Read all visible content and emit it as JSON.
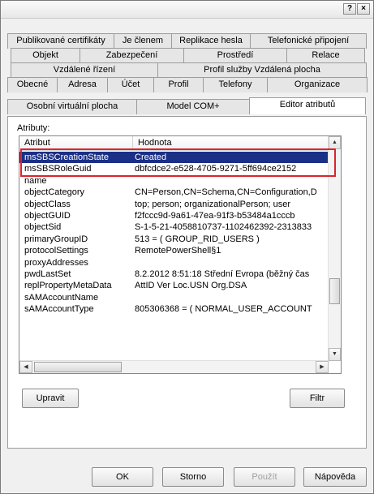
{
  "titlebar": {
    "help": "?",
    "close": "×"
  },
  "tabs": {
    "row1": [
      "Publikované certifikáty",
      "Je členem",
      "Replikace hesla",
      "Telefonické připojení"
    ],
    "row2": [
      "Objekt",
      "Zabezpečení",
      "Prostředí",
      "Relace"
    ],
    "row3": [
      "Vzdálené řízení",
      "Profil služby Vzdálená plocha"
    ],
    "row4": [
      "Obecné",
      "Adresa",
      "Účet",
      "Profil",
      "Telefony",
      "Organizace"
    ],
    "row5": [
      "Osobní virtuální plocha",
      "Model COM+",
      "Editor atributů"
    ]
  },
  "panel": {
    "attributes_label": "Atributy:",
    "columns": {
      "attribute": "Atribut",
      "value": "Hodnota"
    },
    "rows": [
      {
        "a": "msSBSCreationState",
        "v": "Created"
      },
      {
        "a": "msSBSRoleGuid",
        "v": "dbfcdce2-e528-4705-9271-5ff694ce2152"
      },
      {
        "a": "name",
        "v": ""
      },
      {
        "a": "objectCategory",
        "v": "CN=Person,CN=Schema,CN=Configuration,D"
      },
      {
        "a": "objectClass",
        "v": "top; person; organizationalPerson; user"
      },
      {
        "a": "objectGUID",
        "v": "f2fccc9d-9a61-47ea-91f3-b53484a1cccb"
      },
      {
        "a": "objectSid",
        "v": "S-1-5-21-4058810737-1102462392-2313833"
      },
      {
        "a": "primaryGroupID",
        "v": "513 = ( GROUP_RID_USERS )"
      },
      {
        "a": "protocolSettings",
        "v": "RemotePowerShell§1"
      },
      {
        "a": "proxyAddresses",
        "v": ""
      },
      {
        "a": "pwdLastSet",
        "v": "8.2.2012 8:51:18 Střední Evropa (běžný čas"
      },
      {
        "a": "replPropertyMetaData",
        "v": "AttID  Ver   Loc.USN          Org.DSA"
      },
      {
        "a": "sAMAccountName",
        "v": ""
      },
      {
        "a": "sAMAccountType",
        "v": "805306368 = ( NORMAL_USER_ACCOUNT"
      }
    ],
    "edit_button": "Upravit",
    "filter_button": "Filtr"
  },
  "footer": {
    "ok": "OK",
    "cancel": "Storno",
    "apply": "Použít",
    "help": "Nápověda"
  },
  "colors": {
    "selection": "#1b2f86",
    "highlight_box": "#d9252c"
  }
}
